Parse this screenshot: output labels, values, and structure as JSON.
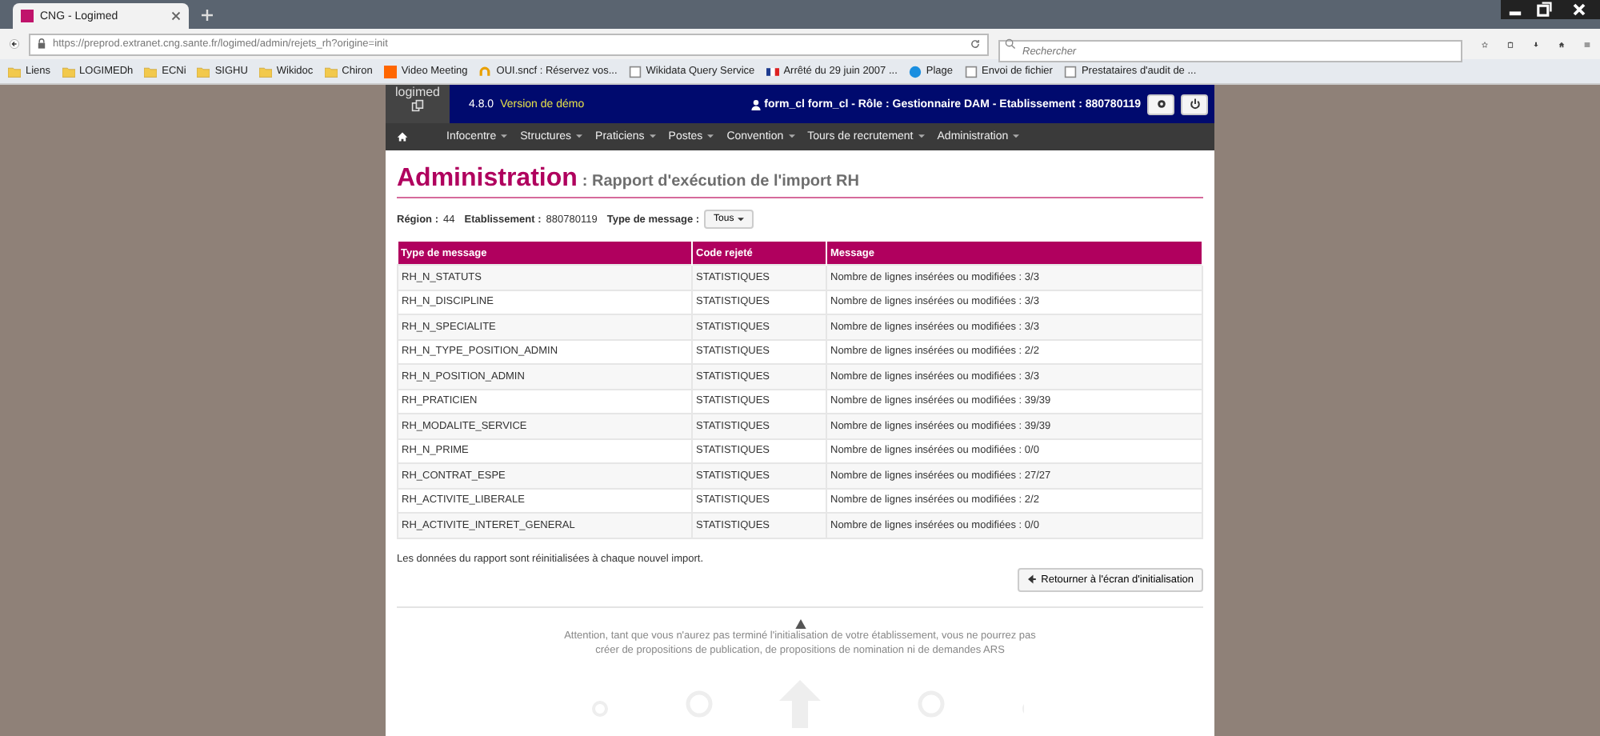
{
  "browser": {
    "tabs": [
      {
        "title": "CNG - Logimed",
        "selected": true
      }
    ],
    "url": "https://preprod.extranet.cng.sante.fr/logimed/admin/rejets_rh?origine=init",
    "search": {
      "placeholder": "Rechercher"
    },
    "bookmarks": [
      {
        "label": "Liens",
        "kind": "folder"
      },
      {
        "label": "LOGIMEDh",
        "kind": "folder"
      },
      {
        "label": "ECNi",
        "kind": "folder"
      },
      {
        "label": "SIGHU",
        "kind": "folder"
      },
      {
        "label": "Wikidoc",
        "kind": "folder"
      },
      {
        "label": "Chiron",
        "kind": "folder"
      },
      {
        "label": "Video Meeting",
        "kind": "orange"
      },
      {
        "label": "OUI.sncf : Réservez vos...",
        "kind": "ring"
      },
      {
        "label": "Wikidata Query Service",
        "kind": "page"
      },
      {
        "label": "Arrêté du 29 juin 2007 ...",
        "kind": "flag"
      },
      {
        "label": "Plage",
        "kind": "globe"
      },
      {
        "label": "Envoi de fichier",
        "kind": "page"
      },
      {
        "label": "Prestataires d'audit de ...",
        "kind": "page"
      }
    ]
  },
  "app": {
    "logo": "logimed",
    "version": "4.8.0",
    "version_label": "Version de démo",
    "user": "form_cl form_cl - Rôle : Gestionnaire DAM - Etablissement : 880780119",
    "menu": [
      {
        "label": "Infocentre"
      },
      {
        "label": "Structures"
      },
      {
        "label": "Praticiens"
      },
      {
        "label": "Postes"
      },
      {
        "label": "Convention"
      },
      {
        "label": "Tours de recrutement"
      },
      {
        "label": "Administration"
      }
    ],
    "title": "Administration",
    "subtitle": ": Rapport d'exécution de l'import RH",
    "filters": {
      "region_label": "Région :",
      "region": "44",
      "etab_label": "Etablissement :",
      "etab": "880780119",
      "type_label": "Type de message :",
      "type_value": "Tous"
    },
    "table": {
      "columns": [
        "Type de message",
        "Code rejeté",
        "Message"
      ],
      "rows": [
        [
          "RH_N_STATUTS",
          "STATISTIQUES",
          "Nombre de lignes insérées ou modifiées : 3/3"
        ],
        [
          "RH_N_DISCIPLINE",
          "STATISTIQUES",
          "Nombre de lignes insérées ou modifiées : 3/3"
        ],
        [
          "RH_N_SPECIALITE",
          "STATISTIQUES",
          "Nombre de lignes insérées ou modifiées : 3/3"
        ],
        [
          "RH_N_TYPE_POSITION_ADMIN",
          "STATISTIQUES",
          "Nombre de lignes insérées ou modifiées : 2/2"
        ],
        [
          "RH_N_POSITION_ADMIN",
          "STATISTIQUES",
          "Nombre de lignes insérées ou modifiées : 3/3"
        ],
        [
          "RH_PRATICIEN",
          "STATISTIQUES",
          "Nombre de lignes insérées ou modifiées : 39/39"
        ],
        [
          "RH_MODALITE_SERVICE",
          "STATISTIQUES",
          "Nombre de lignes insérées ou modifiées : 39/39"
        ],
        [
          "RH_N_PRIME",
          "STATISTIQUES",
          "Nombre de lignes insérées ou modifiées : 0/0"
        ],
        [
          "RH_CONTRAT_ESPE",
          "STATISTIQUES",
          "Nombre de lignes insérées ou modifiées : 27/27"
        ],
        [
          "RH_ACTIVITE_LIBERALE",
          "STATISTIQUES",
          "Nombre de lignes insérées ou modifiées : 2/2"
        ],
        [
          "RH_ACTIVITE_INTERET_GENERAL",
          "STATISTIQUES",
          "Nombre de lignes insérées ou modifiées : 0/0"
        ]
      ]
    },
    "note": "Les données du rapport sont réinitialisées à chaque nouvel import.",
    "back_button": "Retourner à l'écran d'initialisation",
    "warning": "Attention, tant que vous n'aurez pas terminé l'initialisation de votre établissement, vous ne pourrez pas créer de propositions de publication, de propositions de nomination ni de demandes ARS"
  }
}
